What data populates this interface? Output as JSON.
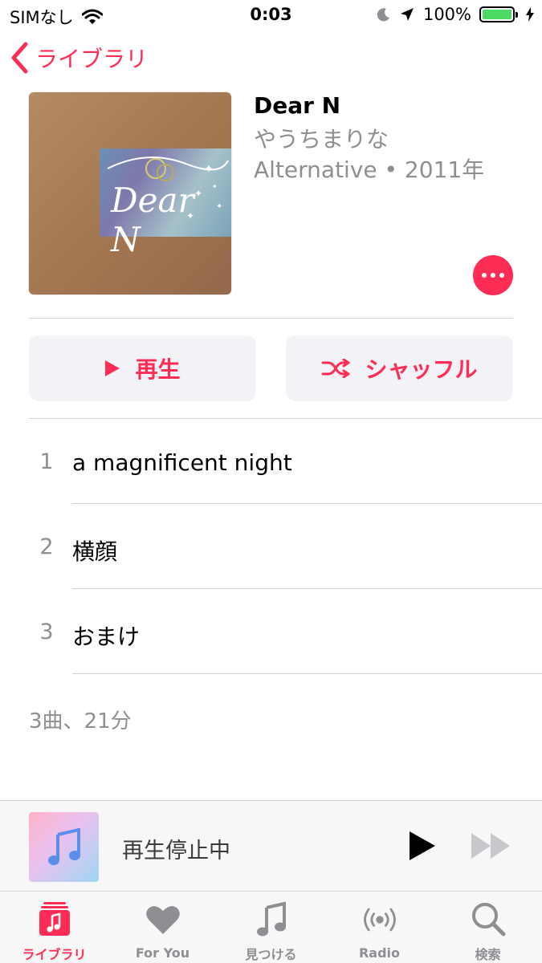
{
  "status_bar": {
    "carrier": "SIMなし",
    "time": "0:03",
    "battery": "100%",
    "battery_level": 1.0,
    "icons": [
      "wifi-icon",
      "moon-icon",
      "location-icon",
      "battery-icon",
      "charging-icon"
    ]
  },
  "nav": {
    "back_label": "ライブラリ"
  },
  "album": {
    "title": "Dear N",
    "artist": "やうちまりな",
    "meta": "Alternative • 2011年",
    "art_text": "Dear N"
  },
  "actions": {
    "play_label": "再生",
    "shuffle_label": "シャッフル"
  },
  "tracks": [
    {
      "number": "1",
      "title": "a magnificent night"
    },
    {
      "number": "2",
      "title": "横顔"
    },
    {
      "number": "3",
      "title": "おまけ"
    }
  ],
  "summary": "3曲、21分",
  "mini_player": {
    "status": "再生停止中"
  },
  "tab_bar": {
    "tabs": [
      {
        "label": "ライブラリ",
        "icon": "library-icon",
        "active": true
      },
      {
        "label": "For You",
        "icon": "heart-icon",
        "active": false
      },
      {
        "label": "見つける",
        "icon": "music-note-icon",
        "active": false
      },
      {
        "label": "Radio",
        "icon": "radio-icon",
        "active": false
      },
      {
        "label": "検索",
        "icon": "search-icon",
        "active": false
      }
    ]
  },
  "colors": {
    "accent": "#ff2d55",
    "secondary_text": "#8e8e93",
    "battery": "#4cd964"
  }
}
